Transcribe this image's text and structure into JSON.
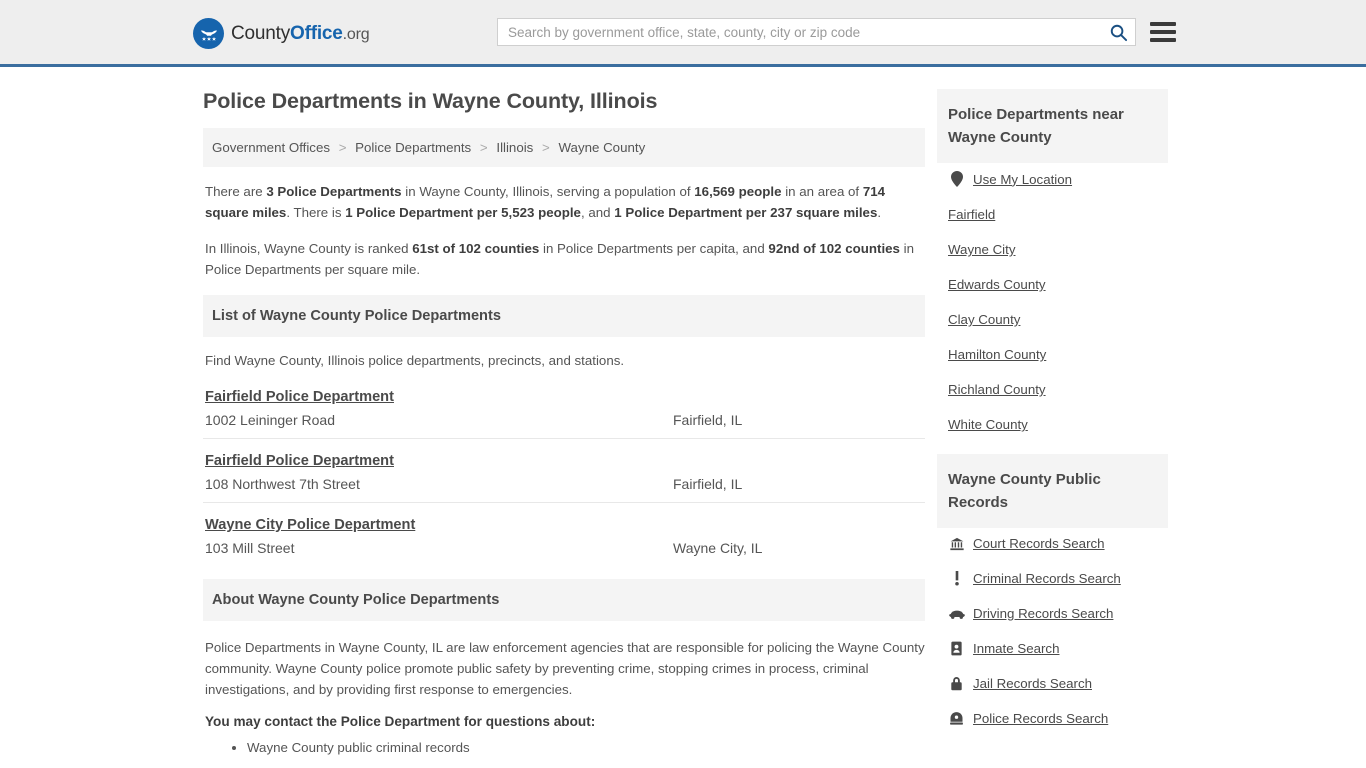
{
  "header": {
    "brand": {
      "part1": "County",
      "part2": "Office",
      "part3": ".org"
    },
    "search": {
      "placeholder": "Search by government office, state, county, city or zip code",
      "value": ""
    },
    "search_icon": "search-icon",
    "menu_icon": "hamburger-menu-icon"
  },
  "main": {
    "title": "Police Departments in Wayne County, Illinois",
    "breadcrumb": [
      "Government Offices",
      "Police Departments",
      "Illinois",
      "Wayne County"
    ],
    "breadcrumb_separator": ">",
    "intro": {
      "p1_a": "There are ",
      "p1_b1": "3 Police Departments",
      "p1_c": " in Wayne County, Illinois, serving a population of ",
      "p1_b2": "16,569 people",
      "p1_d": " in an area of ",
      "p1_b3": "714 square miles",
      "p1_e": ". There is ",
      "p1_b4": "1 Police Department per 5,523 people",
      "p1_f": ", and ",
      "p1_b5": "1 Police Department per 237 square miles",
      "p1_g": ".",
      "p2_a": "In Illinois, Wayne County is ranked ",
      "p2_b1": "61st of 102 counties",
      "p2_c": " in Police Departments per capita, and ",
      "p2_b2": "92nd of 102 counties",
      "p2_d": " in Police Departments per square mile."
    },
    "list_section": {
      "heading": "List of Wayne County Police Departments",
      "subtitle": "Find Wayne County, Illinois police departments, precincts, and stations.",
      "departments": [
        {
          "name": "Fairfield Police Department",
          "address": "1002 Leininger Road",
          "city": "Fairfield, IL"
        },
        {
          "name": "Fairfield Police Department",
          "address": "108 Northwest 7th Street",
          "city": "Fairfield, IL"
        },
        {
          "name": "Wayne City Police Department",
          "address": "103 Mill Street",
          "city": "Wayne City, IL"
        }
      ]
    },
    "about_section": {
      "heading": "About Wayne County Police Departments",
      "paragraph": "Police Departments in Wayne County, IL are law enforcement agencies that are responsible for policing the Wayne County community. Wayne County police promote public safety by preventing crime, stopping crimes in process, criminal investigations, and by providing first response to emergencies.",
      "contact_heading": "You may contact the Police Department for questions about:",
      "bullets": [
        "Wayne County public criminal records"
      ]
    }
  },
  "sidebar": {
    "nearby": {
      "heading": "Police Departments near Wayne County",
      "items": [
        {
          "label": "Use My Location",
          "icon": "map-pin-icon"
        },
        {
          "label": "Fairfield",
          "icon": ""
        },
        {
          "label": "Wayne City",
          "icon": ""
        },
        {
          "label": "Edwards County",
          "icon": ""
        },
        {
          "label": "Clay County",
          "icon": ""
        },
        {
          "label": "Hamilton County",
          "icon": ""
        },
        {
          "label": "Richland County",
          "icon": ""
        },
        {
          "label": "White County",
          "icon": ""
        }
      ]
    },
    "public_records": {
      "heading": "Wayne County Public Records",
      "items": [
        {
          "label": "Court Records Search",
          "icon": "courthouse-icon"
        },
        {
          "label": "Criminal Records Search",
          "icon": "exclamation-icon"
        },
        {
          "label": "Driving Records Search",
          "icon": "car-icon"
        },
        {
          "label": "Inmate Search",
          "icon": "id-badge-icon"
        },
        {
          "label": "Jail Records Search",
          "icon": "padlock-icon"
        },
        {
          "label": "Police Records Search",
          "icon": "police-badge-icon"
        }
      ]
    }
  },
  "colors": {
    "brand_blue": "#1664ad",
    "header_border": "#3b6e9f",
    "header_bg": "#eeeeee",
    "panel_bg": "#f4f4f4",
    "text": "#555555"
  }
}
